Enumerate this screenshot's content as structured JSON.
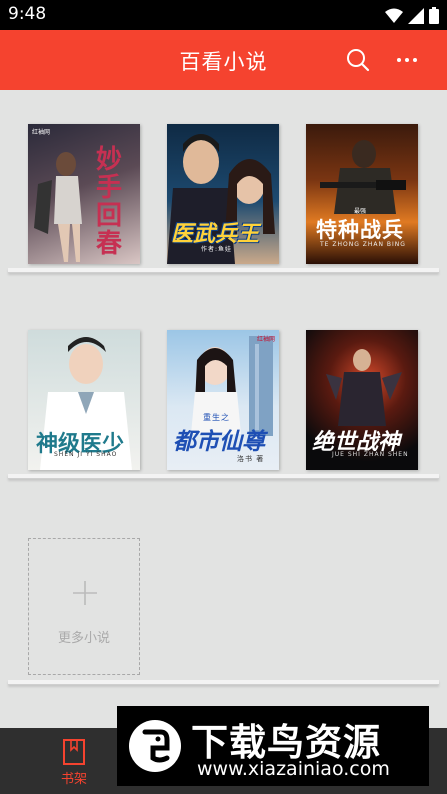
{
  "status_bar": {
    "time": "9:48"
  },
  "header": {
    "title": "百看小说",
    "search_icon": "search-icon",
    "more_icon": "more-icon"
  },
  "books": [
    {
      "cover_title": "妙手回春",
      "badge": "红袖网",
      "palette": [
        "#2b2a3a",
        "#d9c6c4"
      ],
      "accent": "#d03a5a"
    },
    {
      "cover_title": "医武兵王",
      "subtitle": "作者:鱼娃",
      "palette": [
        "#0f2a44",
        "#caa98a"
      ],
      "accent": "#ffd23a"
    },
    {
      "cover_title": "特种战兵",
      "badge": "最强",
      "subtitle": "TE ZHONG ZHAN BING",
      "palette": [
        "#3b1a0c",
        "#e07a22"
      ],
      "accent": "#ffffff"
    },
    {
      "cover_title": "神级医少",
      "subtitle": "SHEN JI YI SHAO",
      "palette": [
        "#cfdcdc",
        "#f2f2ef"
      ],
      "accent": "#1f7a8c"
    },
    {
      "cover_title": "都市仙尊",
      "badge": "红袖网",
      "subtitle": "重生之",
      "author": "洛书 著",
      "palette": [
        "#9cc6e6",
        "#e8eef5"
      ],
      "accent": "#1e4fb4"
    },
    {
      "cover_title": "绝世战神",
      "subtitle": "JUE SHI ZHAN SHEN",
      "palette": [
        "#0a0a0c",
        "#d0482a"
      ],
      "accent": "#ffffff"
    }
  ],
  "add_more": {
    "label": "更多小说",
    "icon": "plus-icon"
  },
  "bottom_nav": {
    "tab_label": "书架",
    "tab_icon": "book-icon"
  },
  "watermark": {
    "title": "下载鸟资源",
    "url": "www.xiazainiao.com"
  }
}
